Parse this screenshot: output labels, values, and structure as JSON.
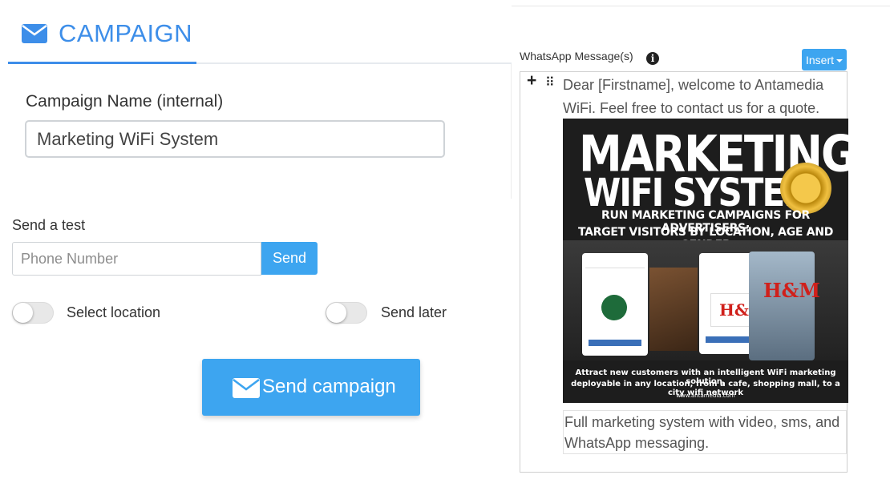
{
  "campaign_tab": {
    "title": "CAMPAIGN",
    "icon": "envelope-icon"
  },
  "campaign_name": {
    "label": "Campaign Name (internal)",
    "value": "Marketing WiFi System"
  },
  "send_test": {
    "label": "Send a test",
    "placeholder": "Phone Number",
    "button": "Send"
  },
  "toggles": {
    "location_label": "Select location",
    "later_label": "Send later",
    "location_on": false,
    "later_on": false
  },
  "send_campaign": {
    "label": "Send campaign",
    "icon": "envelope-icon"
  },
  "whatsapp": {
    "label": "WhatsApp Message(s)",
    "info_icon": "info-icon",
    "insert_label": "Insert",
    "message_text": "Dear [Firstname], welcome to Antamedia WiFi. Feel free to contact us for a quote.",
    "caption_text": "Full marketing system with video, sms, and WhatsApp messaging.",
    "banner": {
      "line1": "MARKETING",
      "line2": "WIFI SYSTEM",
      "subline1": "RUN MARKETING CAMPAIGNS FOR ADVERTISERS:",
      "subline2": "TARGET VISITORS BY LOCATION, AGE AND GENDER",
      "footer1": "Attract new customers with an intelligent WiFi marketing solution,",
      "footer2": "deployable in any location, from a cafe, shopping mall, to a city wifi network",
      "footer3": "www.antamedia.com"
    }
  },
  "colors": {
    "accent": "#3d8ee9",
    "button": "#3da5f0"
  }
}
